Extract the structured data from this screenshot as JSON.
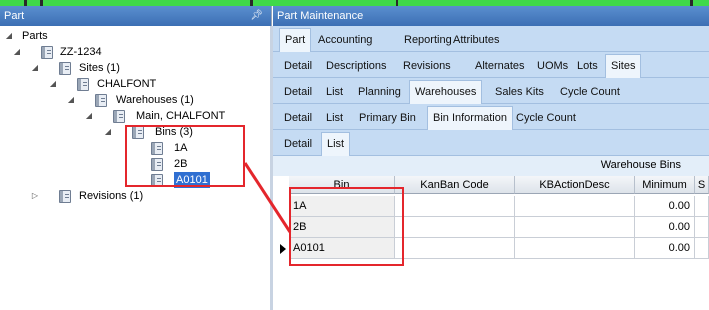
{
  "colors": {
    "topbar": "#3fd94a",
    "title_bar": "#4a7fc3",
    "tab_row": "#c5dbf3",
    "annotation": "#e4262c",
    "selection": "#2f6fd1"
  },
  "left_panel": {
    "title": "Part",
    "pin_icon": "pin-icon",
    "tree": [
      {
        "label": "Parts",
        "expander": "◢"
      },
      {
        "label": "ZZ-1234",
        "expander": "◢"
      },
      {
        "label": "Sites (1)",
        "expander": "◢"
      },
      {
        "label": "CHALFONT",
        "expander": "◢"
      },
      {
        "label": "Warehouses (1)",
        "expander": "◢"
      },
      {
        "label": "Main, CHALFONT",
        "expander": "◢"
      },
      {
        "label": "Bins (3)",
        "expander": "◢"
      },
      {
        "label": "1A",
        "expander": ""
      },
      {
        "label": "2B",
        "expander": ""
      },
      {
        "label": "A0101",
        "expander": ""
      },
      {
        "label": "Revisions (1)",
        "expander": "▷"
      }
    ]
  },
  "main_panel": {
    "title": "Part Maintenance",
    "tab_rows": [
      [
        "Part",
        "Accounting",
        "Reporting",
        "Attributes"
      ],
      [
        "Detail",
        "Descriptions",
        "Revisions",
        "Alternates",
        "UOMs",
        "Lots",
        "Sites"
      ],
      [
        "Detail",
        "List",
        "Planning",
        "Warehouses",
        "Sales Kits",
        "Cycle Count"
      ],
      [
        "Detail",
        "List",
        "Primary Bin",
        "Bin Information",
        "Cycle Count"
      ],
      [
        "Detail",
        "List"
      ]
    ],
    "warehouse_bins": {
      "title": "Warehouse Bins",
      "columns": [
        "Bin",
        "KanBan Code",
        "KBActionDesc",
        "Minimum",
        "S"
      ],
      "rows": [
        {
          "bin": "1A",
          "kanban": "",
          "kbaction": "",
          "minimum": "0.00"
        },
        {
          "bin": "2B",
          "kanban": "",
          "kbaction": "",
          "minimum": "0.00"
        },
        {
          "bin": "A0101",
          "kanban": "",
          "kbaction": "",
          "minimum": "0.00"
        }
      ]
    }
  }
}
